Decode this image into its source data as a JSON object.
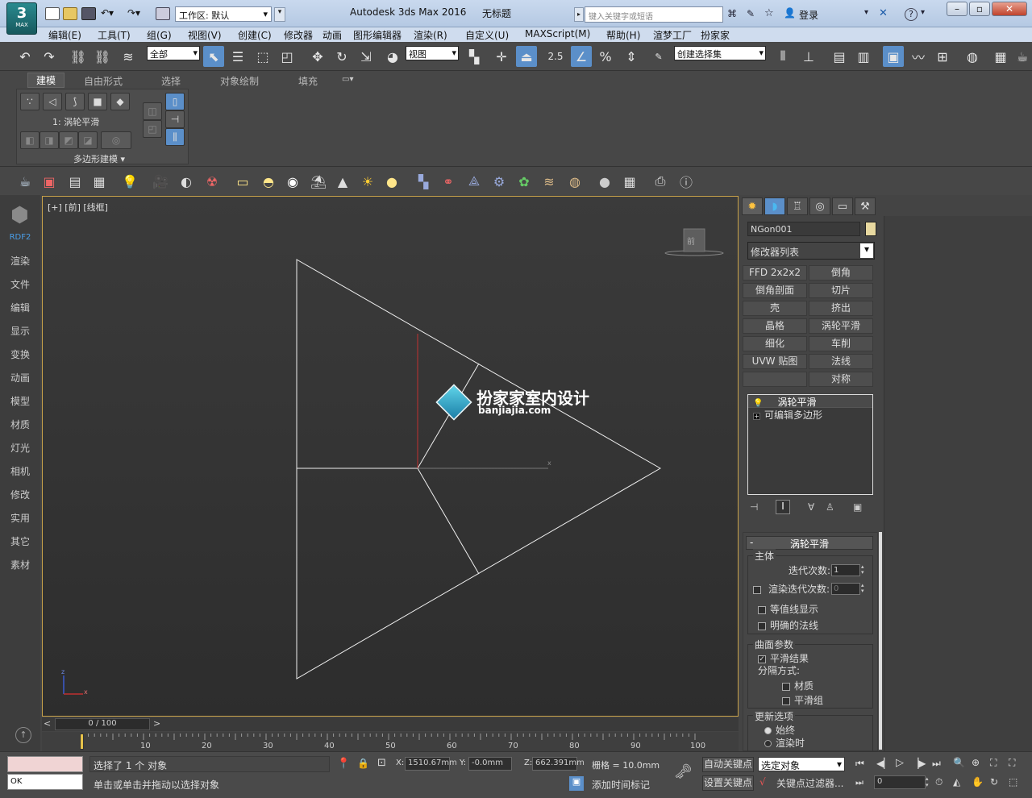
{
  "app": {
    "logo": "MAX",
    "title": "Autodesk 3ds Max 2016",
    "doc_title": "无标题",
    "workspace": "工作区: 默认",
    "search_placeholder": "键入关键字或短语",
    "login": "登录",
    "help": "?"
  },
  "menus": [
    "编辑(E)",
    "工具(T)",
    "组(G)",
    "视图(V)",
    "创建(C)",
    "修改器",
    "动画",
    "图形编辑器",
    "渲染(R)",
    "自定义(U)",
    "MAXScript(M)",
    "帮助(H)",
    "渲梦工厂",
    "扮家家"
  ],
  "toolbar": {
    "selection_filter": "全部",
    "ref_coord": "视图",
    "snap_angle": "2.5",
    "percent_snap": "%",
    "named_selection": "创建选择集"
  },
  "ribbon": {
    "tabs": [
      "建模",
      "自由形式",
      "选择",
      "对象绘制",
      "填充"
    ],
    "modifier_label": "1: 涡轮平滑",
    "section_label": "多边形建模 ▾"
  },
  "left_sidebar": {
    "brand": "RDF2",
    "items": [
      "渲染",
      "文件",
      "编辑",
      "显示",
      "变换",
      "动画",
      "模型",
      "材质",
      "灯光",
      "相机",
      "修改",
      "实用",
      "其它",
      "素材"
    ]
  },
  "viewport": {
    "label": "[+] [前] [线框]",
    "viewcube": "前",
    "watermark_title": "扮家家室内设计",
    "watermark_url": "banjiajia.com",
    "axis_z": "z",
    "axis_x": "x"
  },
  "command_panel": {
    "object_name": "NGon001",
    "object_color": "#e8d9a0",
    "modifier_list": "修改器列表",
    "modifier_buttons": [
      "FFD 2x2x2",
      "倒角",
      "倒角剖面",
      "切片",
      "壳",
      "挤出",
      "晶格",
      "涡轮平滑",
      "细化",
      "车削",
      "UVW 贴图",
      "法线",
      "",
      "对称"
    ],
    "stack": [
      "涡轮平滑",
      "可编辑多边形"
    ],
    "rollout_title": "涡轮平滑",
    "main_group": "主体",
    "iterations_label": "迭代次数:",
    "iterations_value": "1",
    "render_iters_label": "渲染迭代次数:",
    "render_iters_value": "0",
    "isoline_label": "等值线显示",
    "explicit_normals_label": "明确的法线",
    "surface_group": "曲面参数",
    "smooth_result_label": "平滑结果",
    "separate_by_label": "分隔方式:",
    "materials_label": "材质",
    "smoothing_groups_label": "平滑组",
    "update_group": "更新选项",
    "always_label": "始终",
    "when_render_label": "渲染时"
  },
  "timeline": {
    "frame_display": "0 / 100",
    "prev": "<",
    "next": ">",
    "ticks": [
      "10",
      "20",
      "30",
      "40",
      "50",
      "60",
      "70",
      "80",
      "90",
      "100"
    ]
  },
  "statusbar": {
    "maxscript_out": "OK",
    "selection_msg": "选择了 1 个 对象",
    "prompt_msg": "单击或单击并拖动以选择对象",
    "x_label": "X:",
    "x_value": "1510.67mm",
    "y_label": "Y:",
    "y_value": "-0.0mm",
    "z_label": "Z:",
    "z_value": "662.391mm",
    "grid": "栅格 = 10.0mm",
    "add_time_tag": "添加时间标记",
    "auto_key": "自动关键点",
    "selected_object": "选定对象",
    "set_key": "设置关键点",
    "key_filter": "关键点过滤器...",
    "frame_value": "0"
  }
}
